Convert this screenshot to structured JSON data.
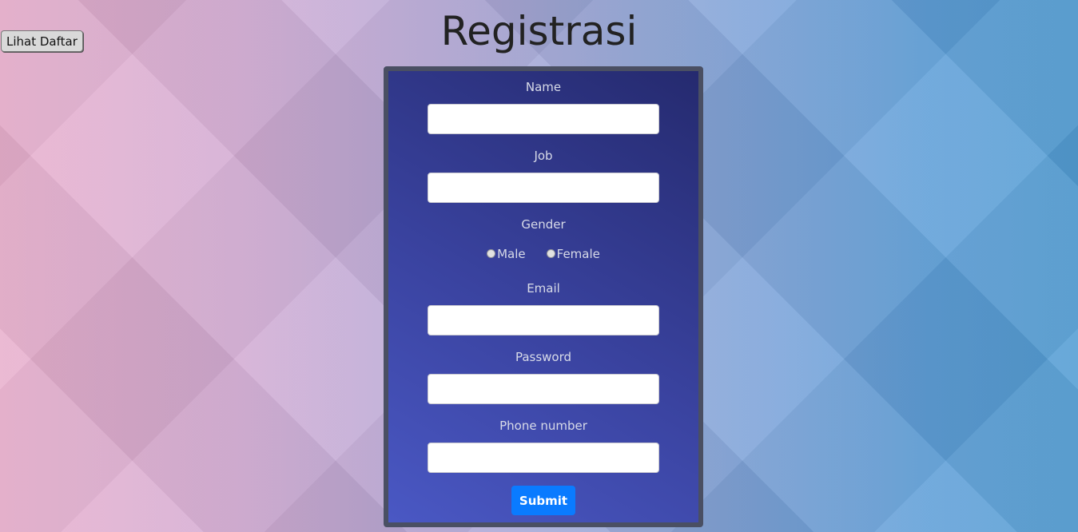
{
  "header": {
    "title": "Registrasi",
    "list_button_label": "Lihat Daftar"
  },
  "form": {
    "name_label": "Name",
    "name_value": "",
    "job_label": "Job",
    "job_value": "",
    "gender_label": "Gender",
    "gender_options": [
      "Male",
      "Female"
    ],
    "gender_selected": "",
    "email_label": "Email",
    "email_value": "",
    "password_label": "Password",
    "password_value": "",
    "phone_label": "Phone number",
    "phone_value": "",
    "submit_label": "Submit"
  },
  "colors": {
    "panel_border": "#4a4f63",
    "panel_bg": "#3a43a0",
    "submit_bg": "#0a7bff",
    "label_text": "#d8dbe8"
  }
}
